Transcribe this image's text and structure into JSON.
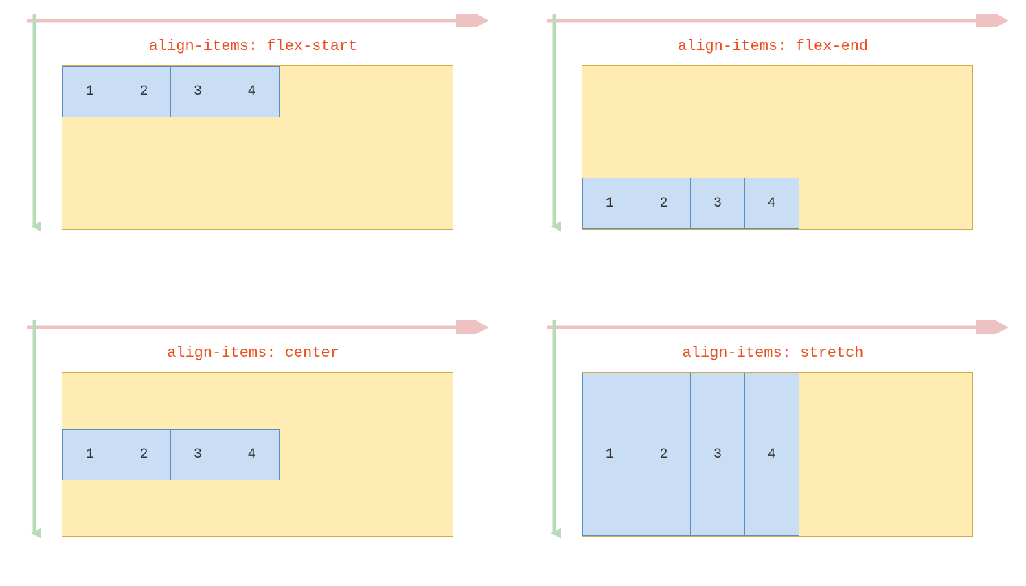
{
  "panels": [
    {
      "id": "flex-start",
      "title": "align-items: flex-start",
      "align_class": "align-start",
      "items": [
        "1",
        "2",
        "3",
        "4"
      ]
    },
    {
      "id": "flex-end",
      "title": "align-items: flex-end",
      "align_class": "align-end",
      "items": [
        "1",
        "2",
        "3",
        "4"
      ]
    },
    {
      "id": "center",
      "title": "align-items: center",
      "align_class": "align-center",
      "items": [
        "1",
        "2",
        "3",
        "4"
      ]
    },
    {
      "id": "stretch",
      "title": "align-items: stretch",
      "align_class": "align-stretch",
      "items": [
        "1",
        "2",
        "3",
        "4"
      ]
    }
  ],
  "colors": {
    "axis_horizontal": "#EEC2C2",
    "axis_vertical": "#B8DBB8",
    "title": "#E84F1C",
    "container_bg": "#FFECB3",
    "container_border": "#D4A843",
    "item_bg": "#C9DEF5",
    "item_border": "#5B8FBF"
  }
}
